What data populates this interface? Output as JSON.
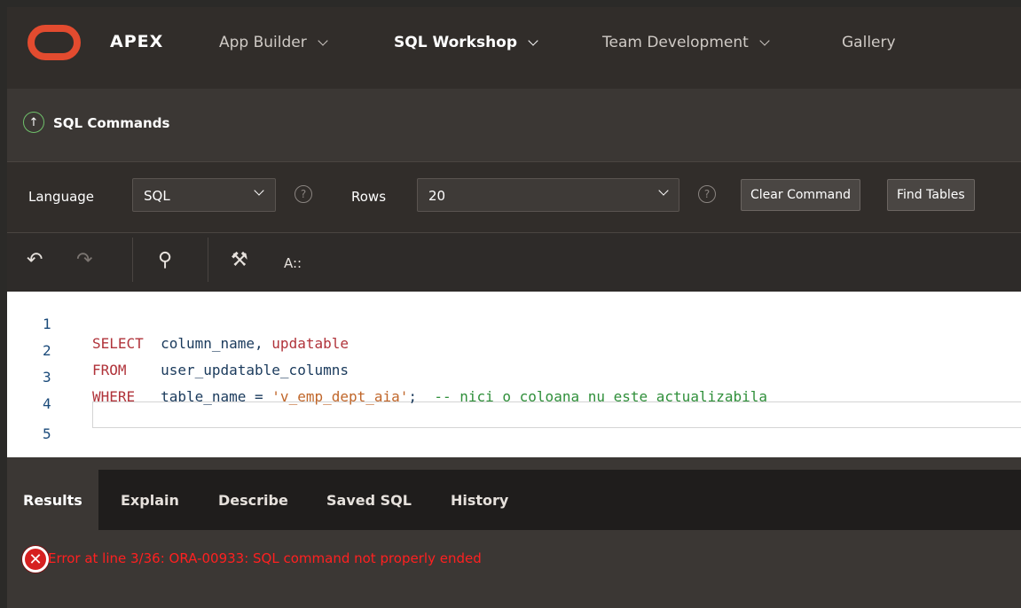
{
  "nav": {
    "brand": "APEX",
    "items": [
      {
        "label": "App Builder",
        "has_menu": true
      },
      {
        "label": "SQL Workshop",
        "has_menu": true,
        "active": true
      },
      {
        "label": "Team Development",
        "has_menu": true
      },
      {
        "label": "Gallery",
        "has_menu": false
      }
    ]
  },
  "page": {
    "title": "SQL Commands"
  },
  "controls": {
    "language_label": "Language",
    "language_value": "SQL",
    "rows_label": "Rows",
    "rows_value": "20",
    "help_glyph": "?",
    "clear_button": "Clear Command",
    "find_button": "Find Tables"
  },
  "toolbar": {
    "undo": "↶",
    "redo": "↷",
    "search": "⚲",
    "hammer": "⚒",
    "format": "A::"
  },
  "editor": {
    "lines": [
      {
        "n": "1",
        "kw": "SELECT",
        "rest": "  column_name, ",
        "fn": "updatable"
      },
      {
        "n": "2",
        "kw": "FROM",
        "rest": "    user_updatable_columns"
      },
      {
        "n": "3",
        "kw": "WHERE",
        "rest": "   table_name = ",
        "str": "'v_emp_dept_aia'",
        "tail": ";  ",
        "cmt": "-- nici o coloana nu este actualizabila"
      },
      {
        "n": "4"
      },
      {
        "n": "5"
      }
    ]
  },
  "tabs": [
    "Results",
    "Explain",
    "Describe",
    "Saved SQL",
    "History"
  ],
  "result": {
    "error_glyph": "✕",
    "message": "Error at line 3/36: ORA-00933: SQL command not properly ended"
  },
  "colors": {
    "brand_red": "#e34b2f",
    "error_red": "#ff2020",
    "keyword": "#b0333a",
    "string": "#c0662a",
    "comment": "#2f8f3a"
  }
}
